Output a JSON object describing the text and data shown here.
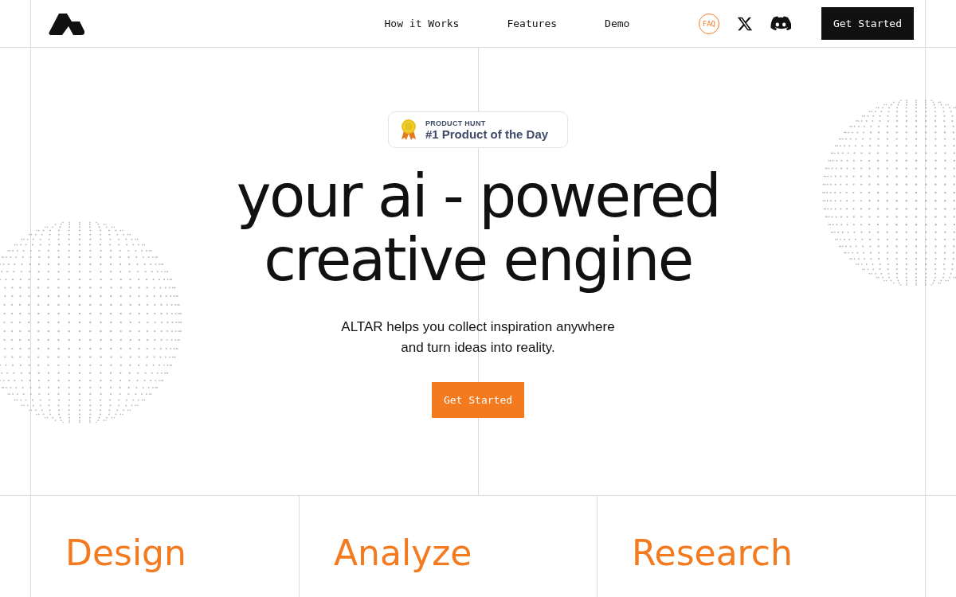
{
  "nav": {
    "links": [
      {
        "label": "How it Works"
      },
      {
        "label": "Features"
      },
      {
        "label": "Demo"
      }
    ],
    "faq": "FAQ",
    "cta": "Get Started"
  },
  "badge": {
    "overline": "PRODUCT HUNT",
    "title": "#1 Product of the Day"
  },
  "hero": {
    "headline_lines": [
      "your ai - powered",
      "creative engine"
    ],
    "subtitle_lines": [
      "ALTAR helps you collect inspiration anywhere",
      "and turn ideas into reality."
    ],
    "cta": "Get Started"
  },
  "features": [
    {
      "title": "Design"
    },
    {
      "title": "Analyze"
    },
    {
      "title": "Research"
    }
  ]
}
